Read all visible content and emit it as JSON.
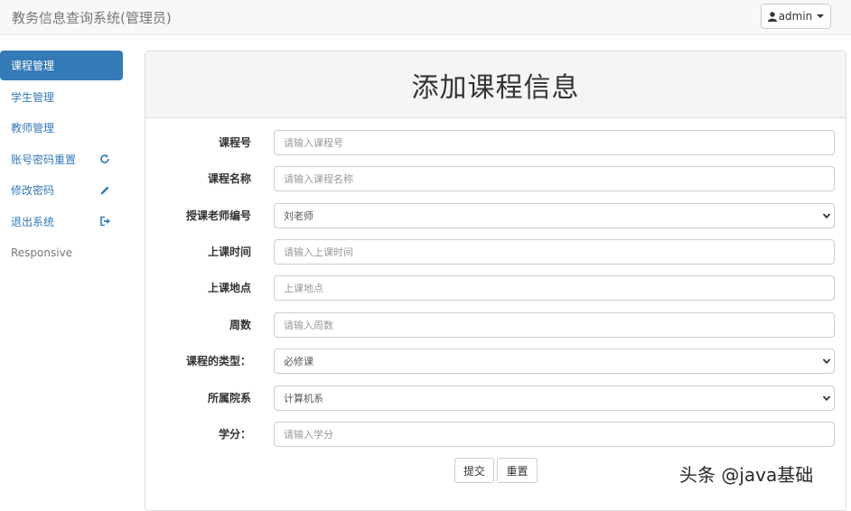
{
  "app": {
    "title": "教务信息查询系统(管理员)",
    "user_label": "admin"
  },
  "sidebar": {
    "items": [
      {
        "label": "课程管理",
        "icon": ""
      },
      {
        "label": "学生管理",
        "icon": ""
      },
      {
        "label": "教师管理",
        "icon": ""
      },
      {
        "label": "账号密码重置",
        "icon": "refresh-icon"
      },
      {
        "label": "修改密码",
        "icon": "pencil-icon"
      },
      {
        "label": "退出系统",
        "icon": "logout-icon"
      },
      {
        "label": "Responsive",
        "icon": ""
      }
    ]
  },
  "form": {
    "title": "添加课程信息",
    "fields": [
      {
        "label": "课程号",
        "placeholder": "请输入课程号"
      },
      {
        "label": "课程名称",
        "placeholder": "请输入课程名称"
      },
      {
        "label": "授课老师编号",
        "value": "刘老师"
      },
      {
        "label": "上课时间",
        "placeholder": "请输入上课时间"
      },
      {
        "label": "上课地点",
        "placeholder": "上课地点"
      },
      {
        "label": "周数",
        "placeholder": "请输入周数"
      },
      {
        "label": "课程的类型：",
        "value": "必修课"
      },
      {
        "label": "所属院系",
        "value": "计算机系"
      },
      {
        "label": "学分：",
        "placeholder": "请输入学分"
      }
    ],
    "submit_label": "提交",
    "reset_label": "重置"
  },
  "watermark": "头条 @java基础",
  "colors": {
    "primary": "#337ab7",
    "navbar_bg": "#f8f8f8",
    "panel_heading_bg": "#f5f5f5"
  }
}
